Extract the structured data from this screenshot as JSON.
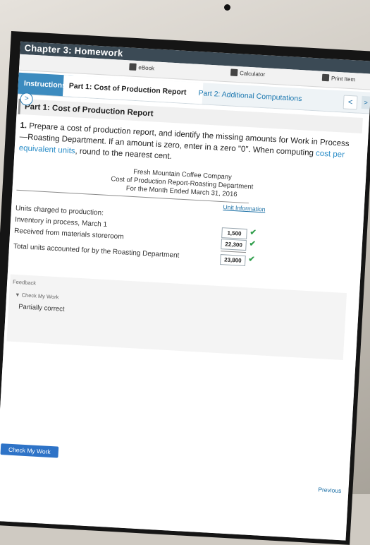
{
  "window": {
    "chapter_title": "Chapter 3: Homework"
  },
  "toolbar": {
    "ebook_label": "eBook",
    "calculator_label": "Calculator",
    "print_label": "Print Item"
  },
  "tabs": {
    "instructions": "Instructions",
    "part1": "Part 1: Cost of Production Report",
    "part2": "Part 2: Additional Computations",
    "nav_arrow": "<",
    "right_arrow": ">"
  },
  "main": {
    "part_heading": "Part 1: Cost of Production Report",
    "instruction_number": "1.",
    "instruction_text": " Prepare a cost of production report, and identify the missing amounts for Work in Process—Roasting Department. If an amount is zero, enter in a zero \"0\". When computing ",
    "instruction_link": "cost per equivalent units",
    "instruction_tail": ", round to the nearest cent.",
    "report": {
      "company": "Fresh Mountain Coffee Company",
      "title": "Cost of Production Report-Roasting Department",
      "period": "For the Month Ended March 31, 2016"
    },
    "column_header": "Unit Information",
    "rows": [
      {
        "label": "Units charged to production:"
      },
      {
        "label": "Inventory in process, March 1",
        "value": "1,500"
      },
      {
        "label": "Received from materials storeroom",
        "value": "22,300"
      },
      {
        "label": "Total units accounted for by the Roasting Department",
        "value": "23,800"
      }
    ],
    "check_mark": "✔"
  },
  "feedback": {
    "label": "Feedback",
    "toggle": "▼ Check My Work",
    "status": "Partially correct"
  },
  "footer": {
    "check_work_button": "Check My Work",
    "previous_button": "Previous"
  },
  "side": {
    "expand_icon": ">"
  },
  "colors": {
    "accent": "#3c8bbf",
    "link": "#2a8dc8",
    "success": "#2f9e4b",
    "button": "#2e73c7"
  }
}
